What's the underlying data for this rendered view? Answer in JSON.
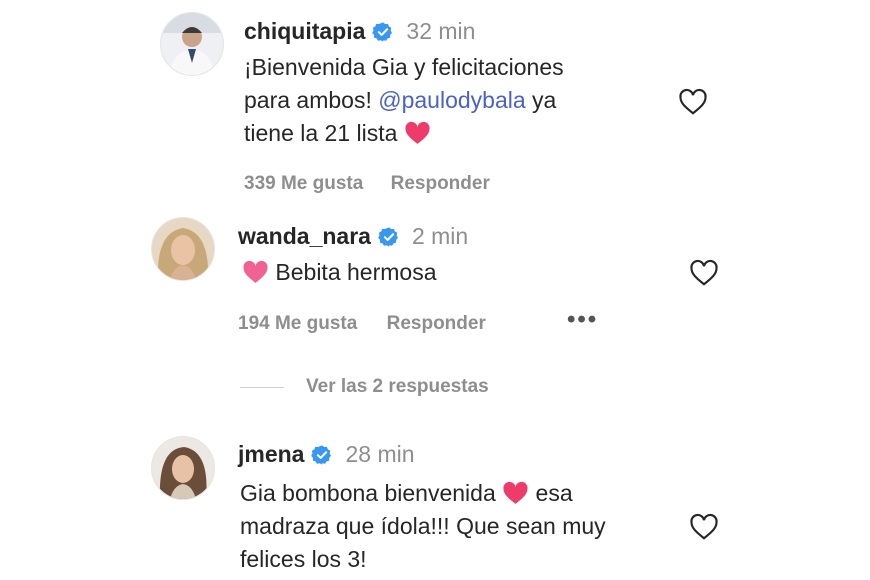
{
  "comments": [
    {
      "username": "chiquitapia",
      "time": "32 min",
      "line1": "¡Bienvenida Gia y felicitaciones",
      "line2_before": "para ambos! ",
      "mention": "@paulodybala",
      "line2_after": " ya",
      "line3": "tiene la 21 lista ",
      "likes": "339 Me gusta",
      "reply": "Responder"
    },
    {
      "username": "wanda_nara",
      "time": "2 min",
      "line1": " Bebita hermosa",
      "likes": "194 Me gusta",
      "reply": "Responder",
      "more": "•••"
    },
    {
      "username": "jmena",
      "time": "28 min",
      "line1": "Gia bombona bienvenida ",
      "line1_after": " esa",
      "line2": "madraza que ídola!!! Que sean muy",
      "line3": "felices los 3!"
    }
  ],
  "view_replies": "Ver las 2 respuestas",
  "colors": {
    "verified": "#3897f0",
    "heart": "#ee3b6b",
    "mention": "#4b61c7",
    "muted": "#8e8e8e"
  },
  "icons": [
    "verified-badge-icon",
    "heart-outline-icon",
    "heart-emoji-icon",
    "more-options-icon"
  ]
}
